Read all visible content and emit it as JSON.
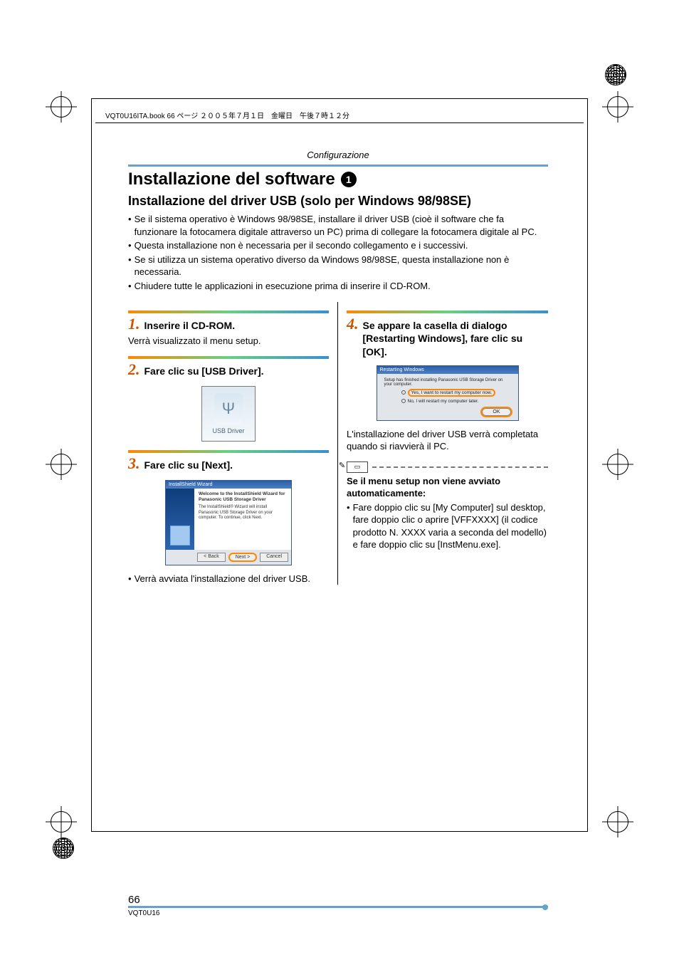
{
  "book_header": "VQT0U16ITA.book  66 ページ  ２００５年７月１日　金曜日　午後７時１２分",
  "section_label": "Configurazione",
  "main_title": "Installazione del software",
  "title_badge": "1",
  "sub_title": "Installazione del driver USB (solo per Windows 98/98SE)",
  "intro_bullets": [
    "Se il sistema operativo è Windows 98/98SE, installare il driver USB (cioè il software che fa funzionare la fotocamera digitale attraverso un PC) prima di collegare la fotocamera digitale al PC.",
    "Questa installazione non è necessaria per il secondo collegamento e i successivi.",
    "Se si utilizza un sistema operativo diverso da Windows 98/98SE, questa installazione non è necessaria.",
    "Chiudere tutte le applicazioni in esecuzione prima di inserire il CD-ROM."
  ],
  "left": {
    "step1": {
      "num": "1",
      "title": "Inserire il CD-ROM.",
      "body": "Verrà visualizzato il menu setup."
    },
    "step2": {
      "num": "2",
      "title": "Fare clic su [USB Driver].",
      "usb_icon_label": "USB Driver"
    },
    "step3": {
      "num": "3",
      "title": "Fare clic su [Next].",
      "wizard": {
        "titlebar": "InstallShield Wizard",
        "heading": "Welcome to the InstallShield Wizard for Panasonic USB Storage Driver",
        "desc": "The InstallShield® Wizard will install Panasonic USB Storage Driver on your computer. To continue, click Next.",
        "btn_back": "< Back",
        "btn_next": "Next >",
        "btn_cancel": "Cancel"
      },
      "after": "Verrà avviata l'installazione del driver USB."
    }
  },
  "right": {
    "step4": {
      "num": "4",
      "title": "Se appare la casella di dialogo [Restarting Windows], fare clic su [OK].",
      "dialog": {
        "titlebar": "Restarting Windows",
        "msg": "Setup has finished installing Panasonic USB Storage Driver on your computer.",
        "opt1": "Yes, I want to restart my computer now.",
        "opt2": "No, I will restart my computer later.",
        "ok": "OK"
      },
      "after": "L'installazione del driver USB verrà completata quando si riavvierà il PC."
    },
    "note": {
      "heading": "Se il menu setup non viene avviato automaticamente:",
      "bullet": "Fare doppio clic su [My Computer] sul desktop, fare doppio clic o aprire [VFFXXXX] (il codice prodotto N. XXXX varia a seconda del modello) e fare doppio clic su [InstMenu.exe]."
    }
  },
  "page_number": "66",
  "page_code": "VQT0U16"
}
